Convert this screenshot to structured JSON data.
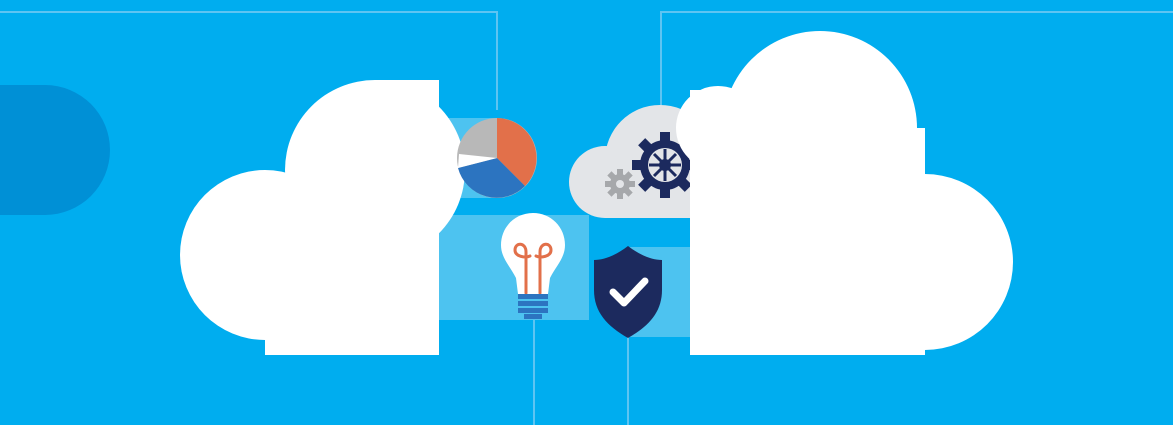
{
  "colors": {
    "background": "#00adef",
    "connector_line": "#5ec4f2",
    "dark_circle": "#0090d6",
    "panel_light": "#4dc3f0",
    "cloud_white": "#ffffff",
    "small_cloud": "#e3e5e8",
    "navy": "#1c2a5e",
    "pie_orange": "#e2704a",
    "pie_blue": "#2c74c0",
    "pie_gray": "#b8b8b8",
    "bulb_filament": "#e2704a",
    "bulb_base": "#2c74c0",
    "gear_small": "#a6a8ab"
  },
  "icons": {
    "pie": "pie-chart-icon",
    "bulb": "lightbulb-icon",
    "shield": "shield-check-icon",
    "gears": "gears-cloud-icon"
  }
}
